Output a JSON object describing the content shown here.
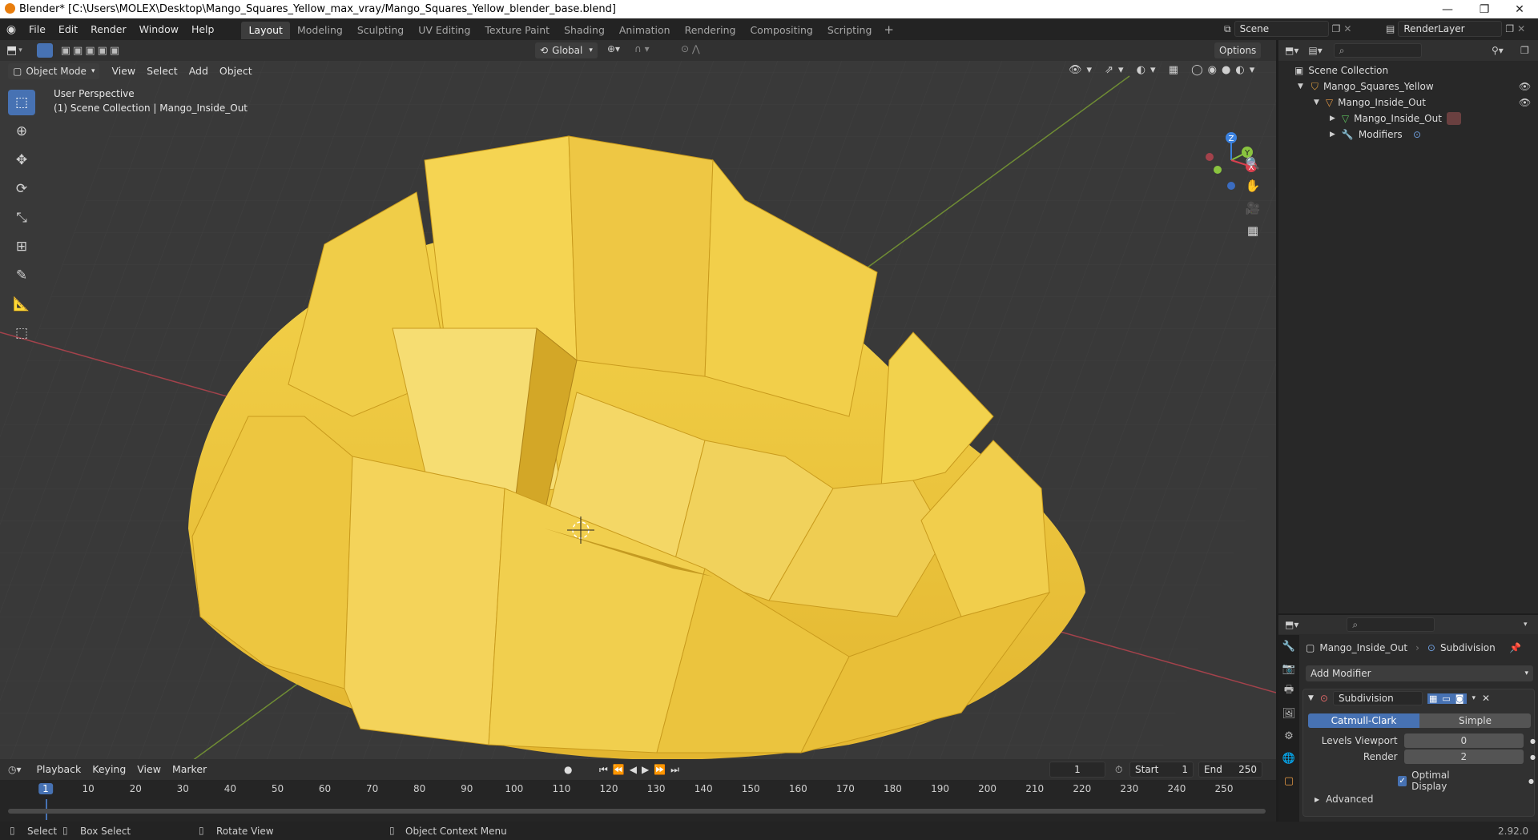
{
  "window": {
    "title": "Blender* [C:\\Users\\MOLEX\\Desktop\\Mango_Squares_Yellow_max_vray/Mango_Squares_Yellow_blender_base.blend]",
    "minimize": "—",
    "restore": "❐",
    "close": "✕"
  },
  "menu": [
    "File",
    "Edit",
    "Render",
    "Window",
    "Help"
  ],
  "workspaces": [
    "Layout",
    "Modeling",
    "Sculpting",
    "UV Editing",
    "Texture Paint",
    "Shading",
    "Animation",
    "Rendering",
    "Compositing",
    "Scripting"
  ],
  "add_workspace": "+",
  "scene": {
    "scene_name": "Scene",
    "render_layer": "RenderLayer"
  },
  "viewport": {
    "mode": "Object Mode",
    "menus": [
      "View",
      "Select",
      "Add",
      "Object"
    ],
    "transform_orientation": "Global",
    "options": "Options",
    "perspective_label": "User Perspective",
    "collection_label": "(1) Scene Collection | Mango_Inside_Out",
    "gizmo": {
      "x": "X",
      "y": "Y",
      "z": "Z"
    }
  },
  "outliner": {
    "root": "Scene Collection",
    "rows": [
      {
        "label": "Mango_Squares_Yellow",
        "icon": "collection-icon"
      },
      {
        "label": "Mango_Inside_Out",
        "icon": "mesh-object-icon"
      },
      {
        "label": "Mango_Inside_Out",
        "icon": "mesh-data-icon"
      },
      {
        "label": "Modifiers",
        "icon": "wrench-icon"
      }
    ]
  },
  "properties": {
    "object_name": "Mango_Inside_Out",
    "modifier_context": "Subdivision",
    "add_modifier": "Add Modifier",
    "modifier_name": "Subdivision",
    "type_catmull": "Catmull-Clark",
    "type_simple": "Simple",
    "levels_viewport_label": "Levels Viewport",
    "levels_viewport_value": "0",
    "render_label": "Render",
    "render_value": "2",
    "optimal_display": "Optimal Display",
    "advanced": "Advanced",
    "version": "2.92.0"
  },
  "timeline": {
    "menus": [
      "Playback",
      "Keying",
      "View",
      "Marker"
    ],
    "current_frame": "1",
    "start_label": "Start",
    "start_value": "1",
    "end_label": "End",
    "end_value": "250",
    "ruler": [
      "1",
      "10",
      "20",
      "30",
      "40",
      "50",
      "60",
      "70",
      "80",
      "90",
      "100",
      "110",
      "120",
      "130",
      "140",
      "150",
      "160",
      "170",
      "180",
      "190",
      "200",
      "210",
      "220",
      "230",
      "240",
      "250"
    ]
  },
  "status": {
    "select": "Select",
    "box_select": "Box Select",
    "rotate_view": "Rotate View",
    "context_menu": "Object Context Menu"
  },
  "colors": {
    "accent": "#4772b3",
    "mango": "#f0c93a",
    "x_axis": "#d9404f",
    "y_axis": "#8ac43f",
    "z_axis": "#3b82e0"
  }
}
